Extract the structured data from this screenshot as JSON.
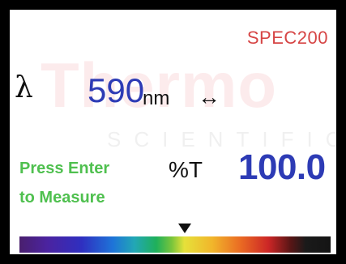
{
  "display": {
    "model": "SPEC200",
    "watermark": {
      "brand": "Thermo",
      "sub": "SCIENTIFIC"
    },
    "wavelength": {
      "symbol": "λ",
      "value": "590",
      "unit": "nm",
      "adjust_symbol": "↔"
    },
    "prompt": {
      "line1": "Press Enter",
      "line2": "to Measure"
    },
    "reading": {
      "label": "%T",
      "value": "100.0"
    },
    "spectrum_position_fraction": 0.53,
    "colors": {
      "bezel": "#000000",
      "screen_bg": "#ffffff",
      "model_text": "#d64545",
      "value_text": "#2d3bb5",
      "prompt_text": "#4fc04f"
    }
  }
}
